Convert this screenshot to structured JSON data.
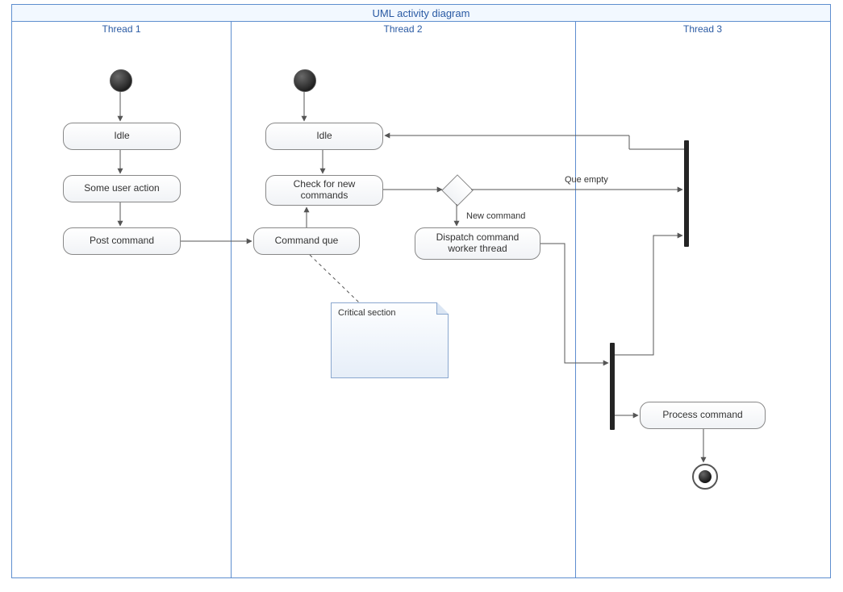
{
  "title": "UML activity diagram",
  "lanes": {
    "one": "Thread 1",
    "two": "Thread 2",
    "three": "Thread 3"
  },
  "activities": {
    "idle1": "Idle",
    "userAction": "Some user action",
    "postCmd": "Post command",
    "idle2": "Idle",
    "checkCmds": "Check for new commands",
    "cmdQue": "Command que",
    "dispatch": "Dispatch command worker thread",
    "processCmd": "Process command"
  },
  "labels": {
    "queEmpty": "Que empty",
    "newCmd": "New command",
    "critical": "Critical section"
  }
}
